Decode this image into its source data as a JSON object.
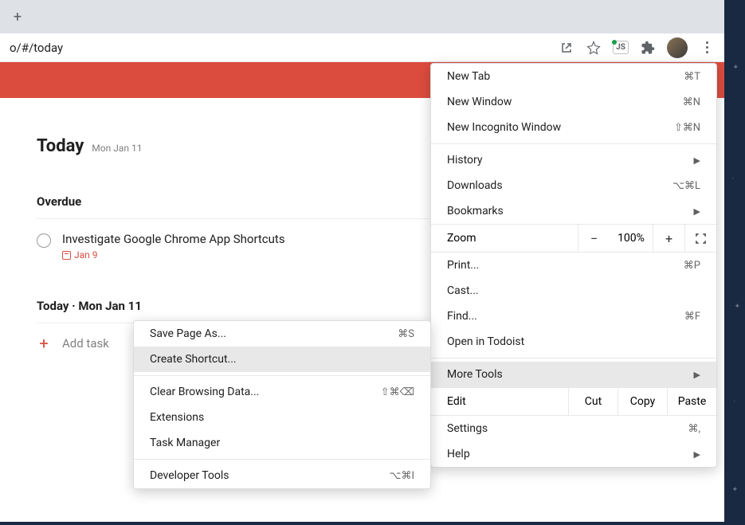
{
  "url": "o/#/today",
  "page": {
    "title": "Today",
    "date": "Mon Jan 11"
  },
  "sections": {
    "overdue": {
      "title": "Overdue",
      "task": {
        "title": "Investigate Google Chrome App Shortcuts",
        "date": "Jan 9"
      }
    },
    "today": {
      "title": "Today · Mon Jan 11"
    }
  },
  "add_task_label": "Add task",
  "main_menu": {
    "new_tab": {
      "label": "New Tab",
      "shortcut": "⌘T"
    },
    "new_window": {
      "label": "New Window",
      "shortcut": "⌘N"
    },
    "incognito": {
      "label": "New Incognito Window",
      "shortcut": "⇧⌘N"
    },
    "history": {
      "label": "History"
    },
    "downloads": {
      "label": "Downloads",
      "shortcut": "⌥⌘L"
    },
    "bookmarks": {
      "label": "Bookmarks"
    },
    "zoom": {
      "label": "Zoom",
      "value": "100%"
    },
    "print": {
      "label": "Print...",
      "shortcut": "⌘P"
    },
    "cast": {
      "label": "Cast..."
    },
    "find": {
      "label": "Find...",
      "shortcut": "⌘F"
    },
    "open_in": {
      "label": "Open in Todoist"
    },
    "more_tools": {
      "label": "More Tools"
    },
    "edit": {
      "label": "Edit",
      "cut": "Cut",
      "copy": "Copy",
      "paste": "Paste"
    },
    "settings": {
      "label": "Settings",
      "shortcut": "⌘,"
    },
    "help": {
      "label": "Help"
    }
  },
  "submenu": {
    "save_page": {
      "label": "Save Page As...",
      "shortcut": "⌘S"
    },
    "create_shortcut": {
      "label": "Create Shortcut..."
    },
    "clear_data": {
      "label": "Clear Browsing Data...",
      "shortcut": "⇧⌘⌫"
    },
    "extensions": {
      "label": "Extensions"
    },
    "task_manager": {
      "label": "Task Manager"
    },
    "dev_tools": {
      "label": "Developer Tools",
      "shortcut": "⌥⌘I"
    }
  }
}
